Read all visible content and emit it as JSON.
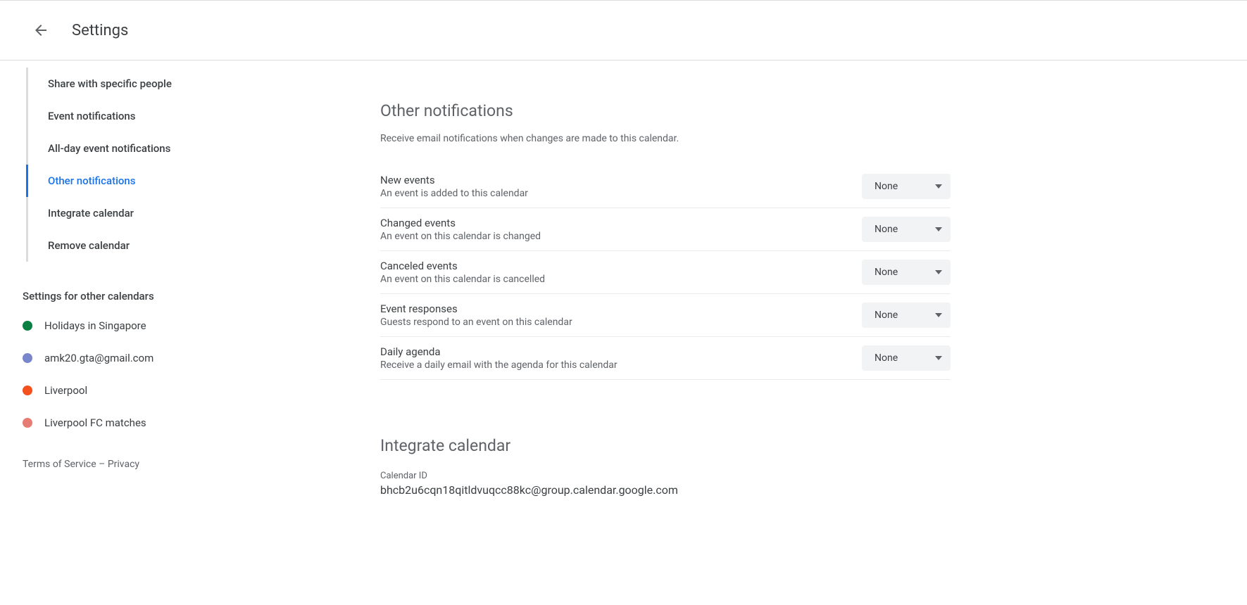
{
  "header": {
    "title": "Settings"
  },
  "sidebar": {
    "nav": [
      {
        "label": "Share with specific people",
        "active": false
      },
      {
        "label": "Event notifications",
        "active": false
      },
      {
        "label": "All-day event notifications",
        "active": false
      },
      {
        "label": "Other notifications",
        "active": true
      },
      {
        "label": "Integrate calendar",
        "active": false
      },
      {
        "label": "Remove calendar",
        "active": false
      }
    ],
    "section_title": "Settings for other calendars",
    "calendars": [
      {
        "label": "Holidays in Singapore",
        "color": "#0b8043"
      },
      {
        "label": "amk20.gta@gmail.com",
        "color": "#7986cb"
      },
      {
        "label": "Liverpool",
        "color": "#f4511e"
      },
      {
        "label": "Liverpool FC matches",
        "color": "#e67c73"
      }
    ],
    "footer": {
      "tos": "Terms of Service",
      "sep": " – ",
      "privacy": "Privacy"
    }
  },
  "main": {
    "other_notifications": {
      "heading": "Other notifications",
      "subheading": "Receive email notifications when changes are made to this calendar.",
      "rows": [
        {
          "title": "New events",
          "desc": "An event is added to this calendar",
          "value": "None"
        },
        {
          "title": "Changed events",
          "desc": "An event on this calendar is changed",
          "value": "None"
        },
        {
          "title": "Canceled events",
          "desc": "An event on this calendar is cancelled",
          "value": "None"
        },
        {
          "title": "Event responses",
          "desc": "Guests respond to an event on this calendar",
          "value": "None"
        },
        {
          "title": "Daily agenda",
          "desc": "Receive a daily email with the agenda for this calendar",
          "value": "None"
        }
      ]
    },
    "integrate": {
      "heading": "Integrate calendar",
      "id_label": "Calendar ID",
      "id_value": "bhcb2u6cqn18qitldvuqcc88kc@group.calendar.google.com"
    }
  }
}
